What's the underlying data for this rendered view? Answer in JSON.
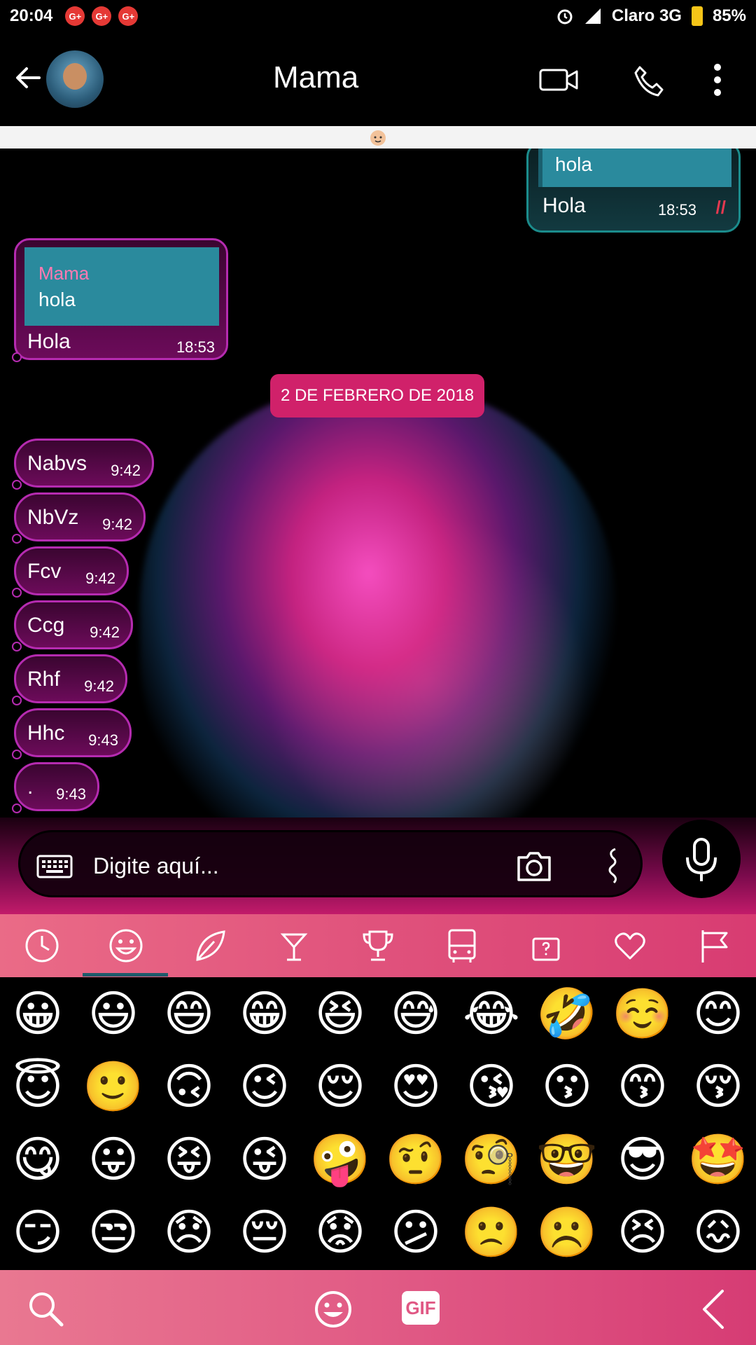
{
  "status_bar": {
    "time": "20:04",
    "notif_badge": "G+",
    "carrier": "Claro 3G",
    "battery": "85%"
  },
  "header": {
    "contact_name": "Mama"
  },
  "messages": {
    "outgoing": {
      "quote_text": "hola",
      "text": "Hola",
      "time": "18:53",
      "ticks": "//"
    },
    "incoming_quoted": {
      "quote_name": "Mama",
      "quote_text": "hola",
      "text": "Hola",
      "time": "18:53"
    },
    "date_chip": "2 DE FEBRERO DE 2018",
    "incoming": [
      {
        "text": "Nabvs",
        "time": "9:42"
      },
      {
        "text": "NbVz",
        "time": "9:42"
      },
      {
        "text": "Fcv",
        "time": "9:42"
      },
      {
        "text": "Ccg",
        "time": "9:42"
      },
      {
        "text": "Rhf",
        "time": "9:42"
      },
      {
        "text": "Hhc",
        "time": "9:43"
      },
      {
        "text": ".",
        "time": "9:43"
      }
    ]
  },
  "composer": {
    "placeholder": "Digite aquí..."
  },
  "emoji_categories": [
    "recent-icon",
    "smileys-icon",
    "nature-icon",
    "food-drink-icon",
    "activity-icon",
    "travel-icon",
    "objects-icon",
    "symbols-icon",
    "flags-icon"
  ],
  "selected_category": "smileys-icon",
  "emojis": [
    "😀",
    "😃",
    "😄",
    "😁",
    "😆",
    "😅",
    "😂",
    "🤣",
    "☺️",
    "😊",
    "😇",
    "🙂",
    "🙃",
    "😉",
    "😌",
    "😍",
    "😘",
    "😗",
    "😙",
    "😚",
    "😋",
    "😛",
    "😝",
    "😜",
    "🤪",
    "🤨",
    "🧐",
    "🤓",
    "😎",
    "🤩",
    "😏",
    "😒",
    "😞",
    "😔",
    "😟",
    "😕",
    "🙁",
    "☹️",
    "😣",
    "😖"
  ],
  "bottom_bar": {
    "gif_label": "GIF"
  },
  "colors": {
    "accent_pink": "#d0216a",
    "bubble_in_border": "#b52bb0",
    "bubble_out_border": "#1b8c8c",
    "quote_teal": "#2a8a9d",
    "tick_red": "#e53950"
  }
}
